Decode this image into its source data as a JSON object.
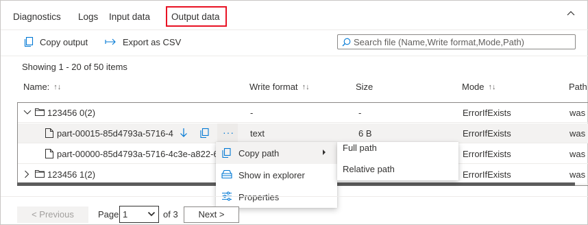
{
  "tabs": [
    {
      "label": "Diagnostics"
    },
    {
      "label": "Logs"
    },
    {
      "label": "Input data"
    },
    {
      "label": "Output data",
      "active": true
    }
  ],
  "toolbar": {
    "copy_output": "Copy output",
    "export_csv": "Export as CSV",
    "search_placeholder": "Search file (Name,Write format,Mode,Path)"
  },
  "showing_text": "Showing 1 - 20 of 50 items",
  "columns": {
    "name": "Name:",
    "write_format": "Write format",
    "size": "Size",
    "mode": "Mode",
    "path": "Path"
  },
  "rows": [
    {
      "name": "123456 0(2)",
      "write_format": "-",
      "size": "-",
      "mode": "ErrorIfExists",
      "path": "was",
      "type": "folder",
      "expanded": true
    },
    {
      "name": "part-00015-85d4793a-5716-4c",
      "write_format": "text",
      "size": "6 B",
      "mode": "ErrorIfExists",
      "path": "was",
      "type": "file",
      "selected": true
    },
    {
      "name": "part-00000-85d4793a-5716-4c3e-a822-6",
      "write_format": "",
      "size": "",
      "mode": "ErrorIfExists",
      "path": "was",
      "type": "file"
    },
    {
      "name": "123456 1(2)",
      "write_format": "",
      "size": "",
      "mode": "ErrorIfExists",
      "path": "was",
      "type": "folder",
      "expanded": false
    }
  ],
  "context_menu": {
    "items": [
      {
        "label": "Copy path",
        "icon": "copy-icon",
        "has_submenu": true
      },
      {
        "label": "Show in explorer",
        "icon": "explorer-icon"
      },
      {
        "label": "Properties",
        "icon": "properties-icon"
      }
    ],
    "submenu": [
      {
        "label": "Full path"
      },
      {
        "label": "Relative path"
      }
    ]
  },
  "pagination": {
    "previous": "< Previous",
    "page_label": "Page",
    "current_page": "1",
    "of_label": "of 3",
    "next": "Next >"
  },
  "colors": {
    "accent": "#0078d4",
    "highlight_border": "#e81123"
  }
}
